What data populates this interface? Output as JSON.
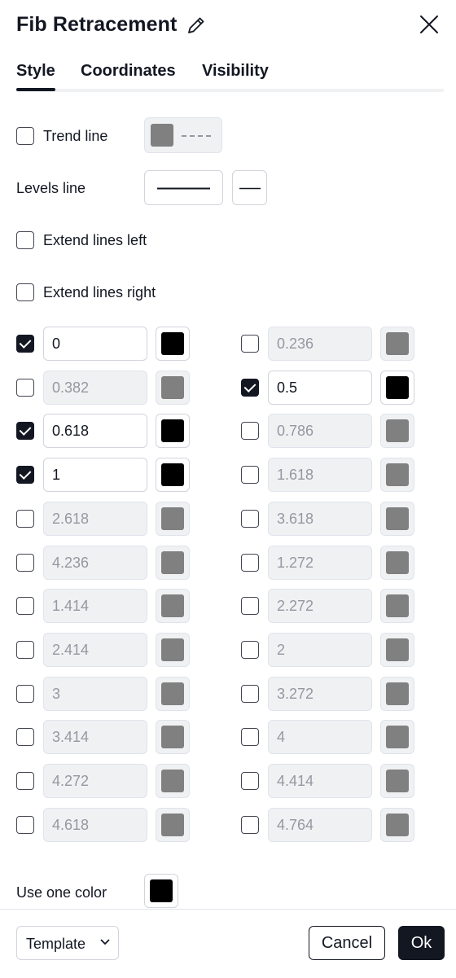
{
  "dialog": {
    "title": "Fib Retracement"
  },
  "tabs": [
    {
      "label": "Style",
      "active": true
    },
    {
      "label": "Coordinates",
      "active": false
    },
    {
      "label": "Visibility",
      "active": false
    }
  ],
  "style": {
    "trend_line": {
      "label": "Trend line",
      "checked": false,
      "color": "#808080",
      "line_style": "dashed"
    },
    "levels_line": {
      "label": "Levels line",
      "line_style": "solid"
    },
    "extend_left": {
      "label": "Extend lines left",
      "checked": false
    },
    "extend_right": {
      "label": "Extend lines right",
      "checked": false
    },
    "levels": [
      {
        "value": "0",
        "checked": true,
        "color": "#000000"
      },
      {
        "value": "0.236",
        "checked": false,
        "color": "#808080"
      },
      {
        "value": "0.382",
        "checked": false,
        "color": "#808080"
      },
      {
        "value": "0.5",
        "checked": true,
        "color": "#000000"
      },
      {
        "value": "0.618",
        "checked": true,
        "color": "#000000"
      },
      {
        "value": "0.786",
        "checked": false,
        "color": "#808080"
      },
      {
        "value": "1",
        "checked": true,
        "color": "#000000"
      },
      {
        "value": "1.618",
        "checked": false,
        "color": "#808080"
      },
      {
        "value": "2.618",
        "checked": false,
        "color": "#808080"
      },
      {
        "value": "3.618",
        "checked": false,
        "color": "#808080"
      },
      {
        "value": "4.236",
        "checked": false,
        "color": "#808080"
      },
      {
        "value": "1.272",
        "checked": false,
        "color": "#808080"
      },
      {
        "value": "1.414",
        "checked": false,
        "color": "#808080"
      },
      {
        "value": "2.272",
        "checked": false,
        "color": "#808080"
      },
      {
        "value": "2.414",
        "checked": false,
        "color": "#808080"
      },
      {
        "value": "2",
        "checked": false,
        "color": "#808080"
      },
      {
        "value": "3",
        "checked": false,
        "color": "#808080"
      },
      {
        "value": "3.272",
        "checked": false,
        "color": "#808080"
      },
      {
        "value": "3.414",
        "checked": false,
        "color": "#808080"
      },
      {
        "value": "4",
        "checked": false,
        "color": "#808080"
      },
      {
        "value": "4.272",
        "checked": false,
        "color": "#808080"
      },
      {
        "value": "4.414",
        "checked": false,
        "color": "#808080"
      },
      {
        "value": "4.618",
        "checked": false,
        "color": "#808080"
      },
      {
        "value": "4.764",
        "checked": false,
        "color": "#808080"
      }
    ],
    "one_color": {
      "label": "Use one color",
      "color": "#000000"
    }
  },
  "footer": {
    "template_label": "Template",
    "cancel_label": "Cancel",
    "ok_label": "Ok"
  },
  "colors": {
    "text": "#131722",
    "accent": "#131722",
    "disabled_bg": "#f0f1f3",
    "border": "#d1d4dc"
  },
  "icons": {
    "edit": "pencil-icon",
    "close": "close-icon",
    "dropdown": "chevron-down-icon",
    "check": "checkmark"
  }
}
